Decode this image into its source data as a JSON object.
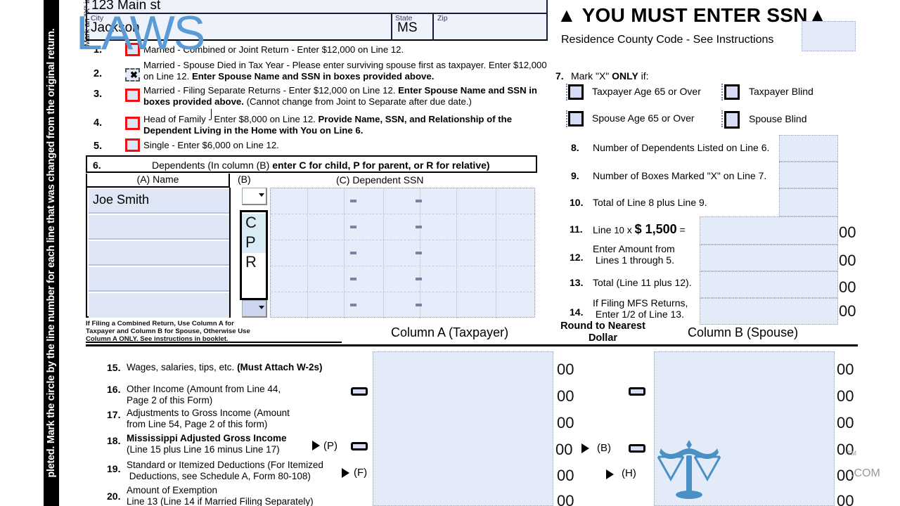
{
  "sidebar": {
    "vertical_note": "pleted.   Mark the circle by the line number for each line that was changed from the original return."
  },
  "address": {
    "street_value": "123 Main st",
    "city_label": "City",
    "city_value": "Jackson",
    "state_label": "State",
    "state_value": "MS",
    "zip_label": "Zip",
    "zip_value": ""
  },
  "filing_status": {
    "vertical_instruction": "Mark an \"X\" in only one box",
    "options": [
      {
        "num": "1.",
        "checked": false,
        "text_html": "Married - Combined or Joint Return - Enter $12,000 on Line 12."
      },
      {
        "num": "2.",
        "checked": true,
        "text_html": "Married - Spouse Died in Tax Year - Please enter surviving spouse first as taxpayer. Enter $12,000 on Line 12. <b>Enter Spouse Name and SSN in boxes provided above.</b>"
      },
      {
        "num": "3.",
        "checked": false,
        "text_html": "Married - Filing Separate Returns - Enter $12,000 on Line 12.  <b>Enter Spouse Name and SSN in boxes provided above.</b>  (Cannot change from Joint to Separate after due date.)"
      },
      {
        "num": "4.",
        "checked": false,
        "text_html": "Head of Family - Enter $8,000 on Line 12.   <b>Provide Name, SSN, and Relationship of the Dependent Living in the Home with You on Line 6.</b>"
      },
      {
        "num": "5.",
        "checked": false,
        "text_html": "Single - Enter $6,000 on Line 12."
      }
    ]
  },
  "dependents": {
    "line_num": "6.",
    "header_html": "Dependents (In column (B) <b>enter C for child, P for parent, or R for relative)</b>",
    "col_a_header": "(A) Name",
    "col_b_header": "(B)",
    "col_c_header": "(C)  Dependent SSN",
    "rows": [
      {
        "name": "Joe Smith",
        "code": "",
        "ssn": ""
      },
      {
        "name": "",
        "code": "",
        "ssn": ""
      },
      {
        "name": "",
        "code": "",
        "ssn": ""
      },
      {
        "name": "",
        "code": "",
        "ssn": ""
      },
      {
        "name": "",
        "code": "",
        "ssn": ""
      }
    ],
    "dropdown_open": true,
    "dropdown_options": [
      "C",
      "P",
      "R"
    ],
    "fine_print": "If Filing a Combined Return, Use Column A for Taxpayer and Column B for Spouse, Otherwise Use Column A ONLY.  See instructions in booklet."
  },
  "columns": {
    "col_a_label": "Column A (Taxpayer)",
    "round_label": "Round to Nearest Dollar",
    "col_b_label": "Column B (Spouse)"
  },
  "right_panel": {
    "ssn_warning": "▲ YOU MUST ENTER SSN▲",
    "residence_line": "Residence  County Code -  See Instructions",
    "county_code_value": "",
    "line7_num": "7.",
    "line7_html": "Mark \"X\" <b>ONLY</b> if:",
    "checkboxes": [
      {
        "label": "Taxpayer Age 65 or Over",
        "checked": false
      },
      {
        "label": "Taxpayer Blind",
        "checked": false
      },
      {
        "label": "Spouse Age 65 or Over",
        "checked": false
      },
      {
        "label": "Spouse Blind",
        "checked": false
      }
    ],
    "lines": [
      {
        "num": "8.",
        "text": "Number of Dependents Listed on Line 6.",
        "value": ""
      },
      {
        "num": "9.",
        "text": "Number of Boxes Marked \"X\" on Line 7.",
        "value": ""
      },
      {
        "num": "10.",
        "text": "Total of Line 8 plus Line 9.",
        "value": ""
      },
      {
        "num": "11.",
        "text_html": "Line <span style=\"font-size:13px\">10</span> x <b style=\"font-size:18px\">$ 1,500</b> =",
        "value": "",
        "cents": "00"
      },
      {
        "num": "12.",
        "text_html": "Enter Amount from<br>&nbsp;Lines 1 through 5.",
        "value": "",
        "cents": "00"
      },
      {
        "num": "13.",
        "text_html": "Total (Line 11 plus 12).",
        "value": "",
        "cents": "00"
      },
      {
        "num": "14.",
        "text_html": "If Filing MFS Returns,<br>&nbsp;Enter 1/2 of Line 13.",
        "value": "",
        "cents": "00"
      }
    ]
  },
  "income_lines": [
    {
      "num": "15.",
      "text_html": "Wages, salaries, tips, etc. <b>(Must Attach W-2s)</b>",
      "a_cents": "00",
      "b_cents": "00",
      "oval_a": false,
      "oval_b": false,
      "marker": "",
      "marker_b": ""
    },
    {
      "num": "16.",
      "text_html": "Other  Income (Amount from Line 44,<br>Page 2 of  this Form)",
      "a_cents": "00",
      "b_cents": "00",
      "oval_a": true,
      "oval_b": true,
      "marker": "",
      "marker_b": ""
    },
    {
      "num": "17.",
      "text_html": "Adjustments to Gross Income (Amount<br>from Line 54, Page 2 of  this form)",
      "a_cents": "00",
      "b_cents": "00",
      "oval_a": false,
      "oval_b": false,
      "marker": "",
      "marker_b": ""
    },
    {
      "num": "18.",
      "text_html": "<b>Mississippi Adjusted Gross Income</b><br>(Line 15 plus Line 16 minus Line 17)",
      "a_cents": "00",
      "b_cents": "00",
      "oval_a": true,
      "oval_b": true,
      "marker": "(P)",
      "marker_b": "(B)"
    },
    {
      "num": "19.",
      "text_html": "Standard or Itemized Deductions (For Itemized<br>&nbsp;Deductions, see Schedule A, Form 80-108)",
      "a_cents": "00",
      "b_cents": "00",
      "oval_a": false,
      "oval_b": false,
      "marker": "(F)",
      "marker_b": "(H)"
    },
    {
      "num": "20.",
      "text_html": "Amount of Exemption<br>Line 13  (Line 14 if Married Filing Separately)",
      "a_cents": "00",
      "b_cents": "00",
      "oval_a": false,
      "oval_b": false,
      "marker": "",
      "marker_b": ""
    }
  ],
  "watermark": {
    "brand": "LAWS",
    "suffix": ".COM",
    "tm": "TM",
    "icon": "scales-of-justice-icon",
    "color": "#5b9bd5"
  }
}
